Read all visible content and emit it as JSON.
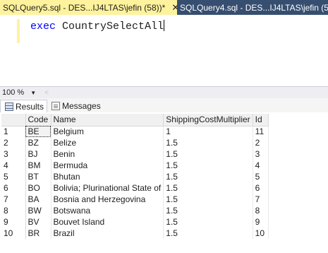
{
  "tabs": [
    {
      "label": "SQLQuery5.sql - DES...IJ4LTAS\\jefin (58))*",
      "close": "✕"
    },
    {
      "label": "SQLQuery4.sql - DES...IJ4LTAS\\jefin (53)"
    }
  ],
  "editor": {
    "keyword": "exec",
    "procedure": "CountrySelectAll"
  },
  "zoom": {
    "value": "100 %"
  },
  "result_tabs": {
    "results": "Results",
    "messages": "Messages"
  },
  "grid": {
    "columns": [
      "Code",
      "Name",
      "ShippingCostMultiplier",
      "Id"
    ],
    "rows": [
      {
        "n": "1",
        "code": "BE",
        "name": "Belgium",
        "mult": "1",
        "id": "11"
      },
      {
        "n": "2",
        "code": "BZ",
        "name": "Belize",
        "mult": "1.5",
        "id": "2"
      },
      {
        "n": "3",
        "code": "BJ",
        "name": "Benin",
        "mult": "1.5",
        "id": "3"
      },
      {
        "n": "4",
        "code": "BM",
        "name": "Bermuda",
        "mult": "1.5",
        "id": "4"
      },
      {
        "n": "5",
        "code": "BT",
        "name": "Bhutan",
        "mult": "1.5",
        "id": "5"
      },
      {
        "n": "6",
        "code": "BO",
        "name": "Bolivia; Plurinational State of",
        "mult": "1.5",
        "id": "6"
      },
      {
        "n": "7",
        "code": "BA",
        "name": "Bosnia and Herzegovina",
        "mult": "1.5",
        "id": "7"
      },
      {
        "n": "8",
        "code": "BW",
        "name": "Botswana",
        "mult": "1.5",
        "id": "8"
      },
      {
        "n": "9",
        "code": "BV",
        "name": "Bouvet Island",
        "mult": "1.5",
        "id": "9"
      },
      {
        "n": "10",
        "code": "BR",
        "name": "Brazil",
        "mult": "1.5",
        "id": "10"
      }
    ]
  }
}
